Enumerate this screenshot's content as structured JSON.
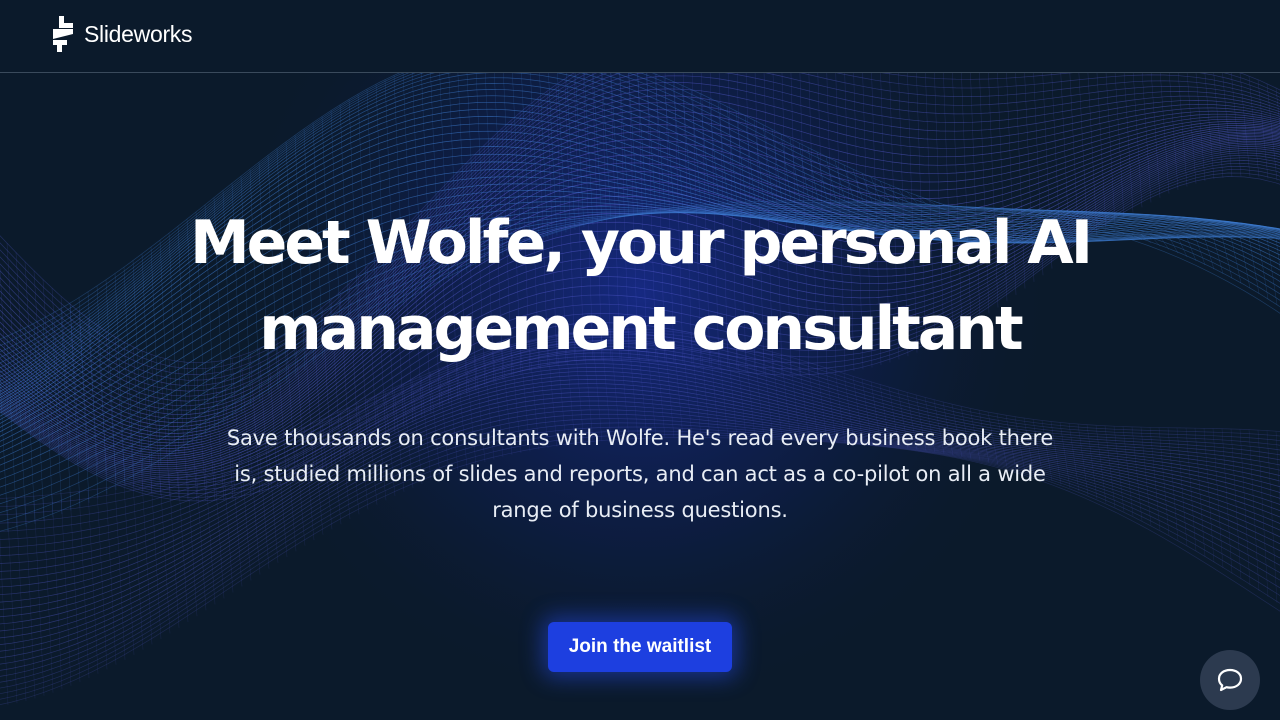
{
  "brand": {
    "name": "Slideworks",
    "logo_icon": "slideworks-s-mark-icon"
  },
  "hero": {
    "title_line1": "Meet Wolfe, your personal AI",
    "title_line2": "management consultant",
    "subtitle": "Save thousands on consultants with Wolfe. He's read every business book there is, studied millions of slides and reports, and can act as a co-pilot on all a wide range of business questions.",
    "cta_label": "Join the waitlist"
  },
  "chat": {
    "icon": "chat-bubble-icon"
  },
  "colors": {
    "background": "#0b1a2b",
    "accent": "#1d3fe0",
    "wave_blue": "#3f7fd6",
    "wave_violet": "#5a5fd8",
    "chat_button": "#2c3a4f"
  }
}
